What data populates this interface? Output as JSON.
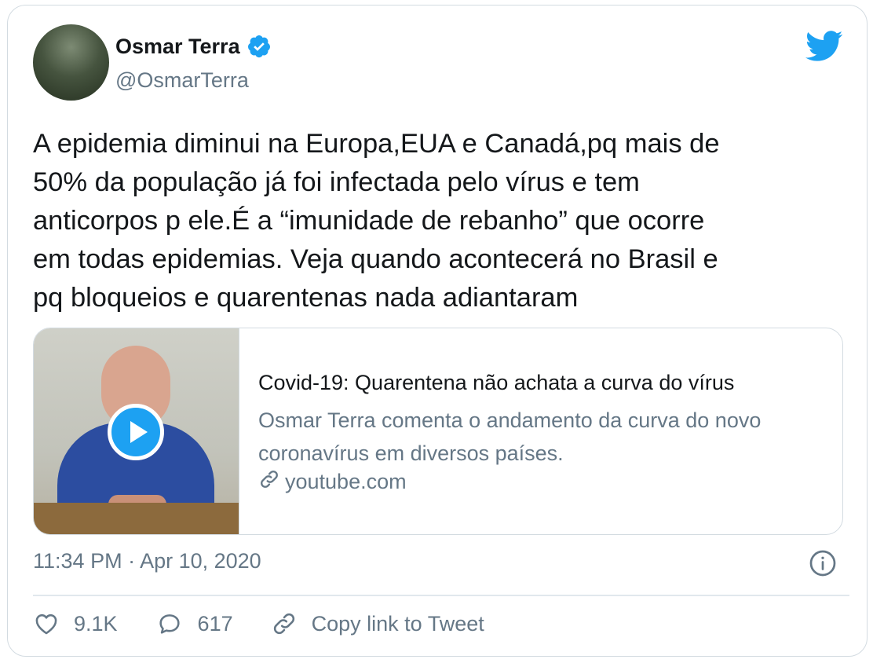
{
  "author": {
    "name": "Osmar Terra",
    "handle": "@OsmarTerra"
  },
  "tweet": {
    "text": "A epidemia diminui na Europa,EUA e Canadá,pq mais de\n50% da população já foi infectada pelo vírus e tem\nanticorpos p ele.É a “imunidade de rebanho” que ocorre\nem todas epidemias. Veja quando acontecerá no Brasil e\npq bloqueios e quarentenas nada adiantaram"
  },
  "link_card": {
    "title": "Covid-19: Quarentena não achata a curva do vírus",
    "description": "Osmar Terra comenta o andamento da curva do novo coronavírus em diversos países.",
    "domain": "youtube.com"
  },
  "timestamp": "11:34 PM · Apr 10, 2020",
  "actions": {
    "likes": "9.1K",
    "replies": "617",
    "copy_link": "Copy link to Tweet"
  },
  "colors": {
    "accent": "#1da1f2",
    "secondary_text": "#657786",
    "border": "#d3dbe1"
  },
  "icons": [
    "verified-badge-icon",
    "twitter-bird-icon",
    "play-icon",
    "link-icon",
    "info-icon",
    "heart-icon",
    "reply-icon"
  ]
}
